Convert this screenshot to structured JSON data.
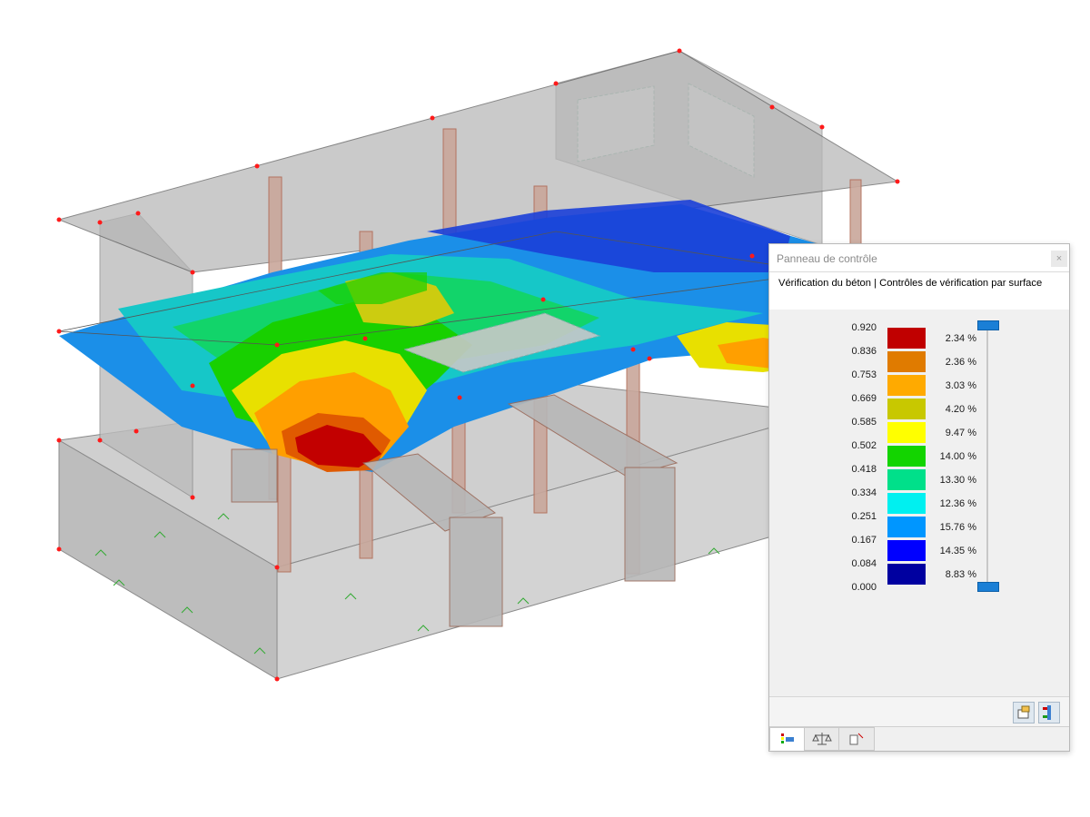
{
  "panel": {
    "title": "Panneau de contrôle",
    "close_glyph": "×",
    "subtitle": "Vérification du béton | Contrôles de vérification par surface"
  },
  "legend": {
    "ticks": [
      "0.920",
      "0.836",
      "0.753",
      "0.669",
      "0.585",
      "0.502",
      "0.418",
      "0.334",
      "0.251",
      "0.167",
      "0.084",
      "0.000"
    ],
    "bands": [
      {
        "color": "#c00000",
        "percent": "2.34 %"
      },
      {
        "color": "#e07b00",
        "percent": "2.36 %"
      },
      {
        "color": "#ffaa00",
        "percent": "3.03 %"
      },
      {
        "color": "#c8c800",
        "percent": "4.20 %"
      },
      {
        "color": "#ffff00",
        "percent": "9.47 %"
      },
      {
        "color": "#13d400",
        "percent": "14.00 %"
      },
      {
        "color": "#00e08a",
        "percent": "13.30 %"
      },
      {
        "color": "#00f0f0",
        "percent": "12.36 %"
      },
      {
        "color": "#0096ff",
        "percent": "15.76 %"
      },
      {
        "color": "#0000ff",
        "percent": "14.35 %"
      },
      {
        "color": "#0000a0",
        "percent": "8.83 %"
      }
    ]
  },
  "icons": {
    "settings": "settings-icon",
    "legend_toggle": "legend-adjust-icon",
    "tab_colors": "color-scale-icon",
    "tab_balance": "balance-icon",
    "tab_results": "results-table-icon"
  }
}
